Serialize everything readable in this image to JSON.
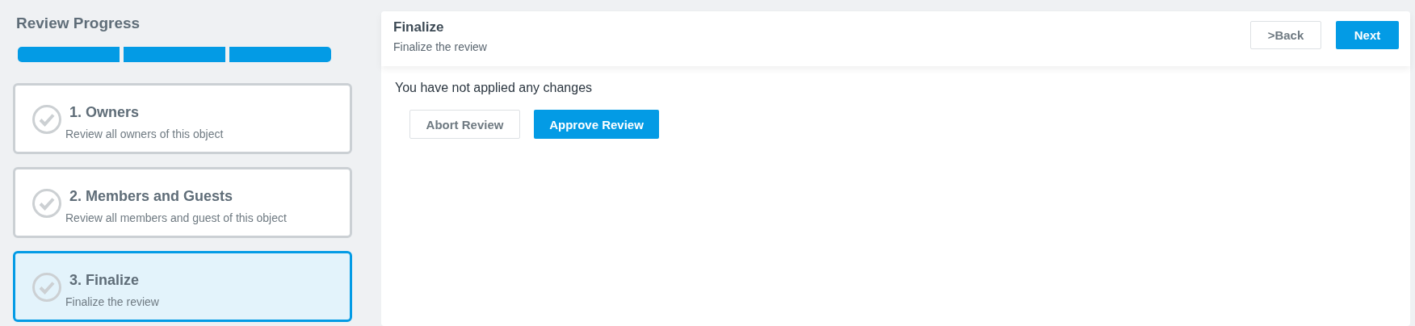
{
  "sidebar": {
    "title": "Review Progress",
    "progress_segments": [
      {
        "complete": true
      },
      {
        "complete": true
      },
      {
        "complete": true
      }
    ],
    "steps": [
      {
        "title": "1. Owners",
        "description": "Review all owners of this object",
        "selected": false
      },
      {
        "title": "2. Members and Guests",
        "description": "Review all members and guest of this object",
        "selected": false
      },
      {
        "title": "3. Finalize",
        "description": "Finalize the review",
        "selected": true
      }
    ]
  },
  "main": {
    "title": "Finalize",
    "subtitle": "Finalize the review",
    "back_button": ">Back",
    "next_button": "Next",
    "message": "You have not applied any changes",
    "abort_button": "Abort Review",
    "approve_button": "Approve Review"
  }
}
